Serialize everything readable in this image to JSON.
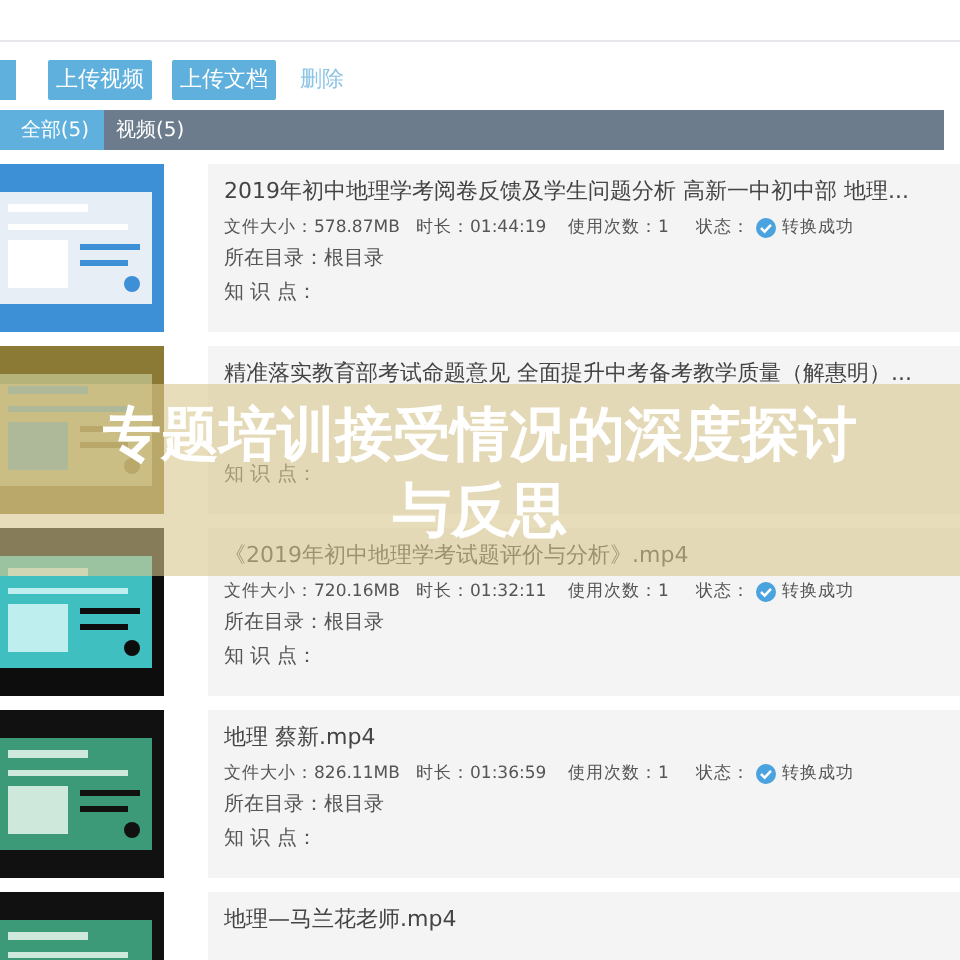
{
  "toolbar": {
    "buttons": [
      {
        "label": "上传视频"
      },
      {
        "label": "上传文档"
      }
    ],
    "link": "删除"
  },
  "tabs": [
    {
      "label": "全部(5)",
      "selected": true
    },
    {
      "label": "视频(5)",
      "selected": false
    }
  ],
  "files": [
    {
      "title": "2019年初中地理学考阅卷反馈及学生问题分析 高新一中初中部 地理...",
      "size": "文件大小：578.87MB",
      "duration": "时长：01:44:19",
      "uses": "使用次数：1",
      "status_label": "状态：",
      "status": "转换成功",
      "directory": "所在目录：根目录",
      "knowledge": "知 识 点："
    },
    {
      "title": "精准落实教育部考试命题意见 全面提升中考备考教学质量（解惠明）...",
      "knowledge": "知 识 点："
    },
    {
      "title": "《2019年初中地理学考试题评价与分析》.mp4",
      "size": "文件大小：720.16MB",
      "duration": "时长：01:32:11",
      "uses": "使用次数：1",
      "status_label": "状态：",
      "status": "转换成功",
      "directory": "所在目录：根目录",
      "knowledge": "知 识 点："
    },
    {
      "title": "地理 蔡新.mp4",
      "size": "文件大小：826.11MB",
      "duration": "时长：01:36:59",
      "uses": "使用次数：1",
      "status_label": "状态：",
      "status": "转换成功",
      "directory": "所在目录：根目录",
      "knowledge": "知 识 点："
    },
    {
      "title": "地理—马兰花老师.mp4"
    }
  ],
  "banner": {
    "title_lines": [
      "专题培训接受情况的深度探讨",
      "与反思"
    ]
  }
}
